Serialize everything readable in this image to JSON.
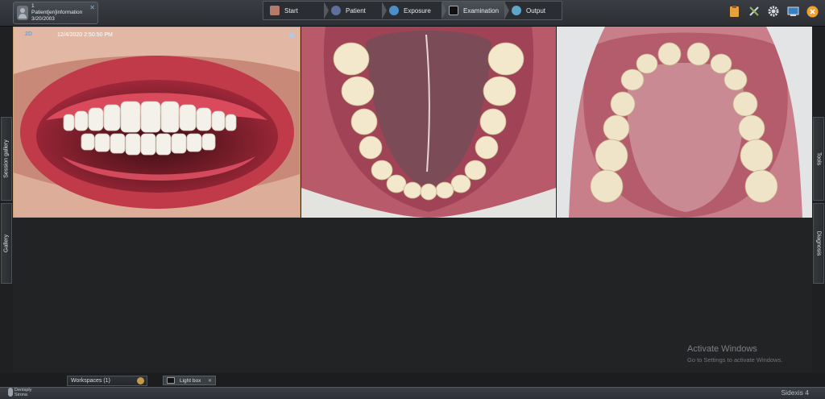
{
  "patient": {
    "line1": "1",
    "line2": "Patient[en]information",
    "line3": "3/20/2003"
  },
  "workflow": {
    "steps": [
      {
        "label": "Start",
        "icon": "home-icon"
      },
      {
        "label": "Patient",
        "icon": "person-icon"
      },
      {
        "label": "Exposure",
        "icon": "globe-icon"
      },
      {
        "label": "Examination",
        "icon": "monitor-icon",
        "active": true
      },
      {
        "label": "Output",
        "icon": "output-globe-icon"
      }
    ]
  },
  "toolbar_icons": [
    "clipboard-icon",
    "tools-icon",
    "gear-icon",
    "window-icon",
    "close-icon"
  ],
  "side_tabs": {
    "left": [
      "Session gallery",
      "Gallery"
    ],
    "right": [
      "Tools",
      "Diagnosis"
    ]
  },
  "images": [
    {
      "overlay_mode": "2D",
      "timestamp": "12/4/2020 2:50:50 PM",
      "icon": "pin-icon",
      "subject": "frontal-teeth-view"
    },
    {
      "subject": "lower-arch-occlusal-view"
    },
    {
      "subject": "upper-arch-occlusal-view"
    }
  ],
  "watermark": {
    "title": "Activate Windows",
    "subtitle": "Go to Settings to activate Windows."
  },
  "bottom": {
    "workspaces_label": "Workspaces (1)",
    "lightbox_label": "Light box",
    "brand_line1": "Dentsply",
    "brand_line2": "Sirona",
    "product": "Sidexis 4"
  },
  "colors": {
    "active_border": "#c9a36b",
    "accent_blue": "#4ab0ff",
    "close_orange": "#f2a031"
  }
}
